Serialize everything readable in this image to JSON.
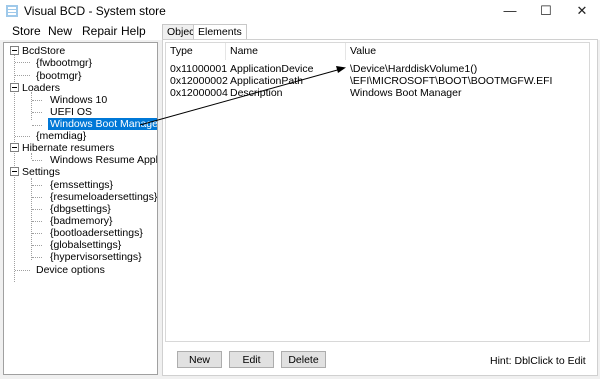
{
  "window": {
    "title": "Visual BCD - System store"
  },
  "menu": [
    "Store",
    "New",
    "Repair",
    "Help"
  ],
  "tree": {
    "root": "BcdStore",
    "fwbootmgr": "{fwbootmgr}",
    "bootmgr": "{bootmgr}",
    "loaders": "Loaders",
    "win10": "Windows 10",
    "uefios": "UEFI OS",
    "wbm": "Windows Boot Manager",
    "memdiag": "{memdiag}",
    "hibernate": "Hibernate resumers",
    "winresume": "Windows Resume Applicatio",
    "settings": "Settings",
    "emssettings": "{emssettings}",
    "resumeloadersettings": "{resumeloadersettings}",
    "dbgsettings": "{dbgsettings}",
    "badmemory": "{badmemory}",
    "bootloadersettings": "{bootloadersettings}",
    "globalsettings": "{globalsettings}",
    "hypervisorsettings": "{hypervisorsettings}",
    "devopts": "Device options"
  },
  "tabs": {
    "object": "Object",
    "elements": "Elements"
  },
  "columns": {
    "type": "Type",
    "name": "Name",
    "value": "Value"
  },
  "rows": [
    {
      "type": "0x11000001",
      "name": "ApplicationDevice",
      "value": "\\Device\\HarddiskVolume1()"
    },
    {
      "type": "0x12000002",
      "name": "ApplicationPath",
      "value": "\\EFI\\MICROSOFT\\BOOT\\BOOTMGFW.EFI"
    },
    {
      "type": "0x12000004",
      "name": "Description",
      "value": "Windows Boot Manager"
    }
  ],
  "buttons": {
    "new": "New",
    "edit": "Edit",
    "delete": "Delete"
  },
  "hint": "Hint: DblClick to Edit",
  "colors": {
    "selection": "#0078d7"
  },
  "window_icons": {
    "minimize": "minimize-icon",
    "maximize": "maximize-icon",
    "close": "close-icon"
  }
}
